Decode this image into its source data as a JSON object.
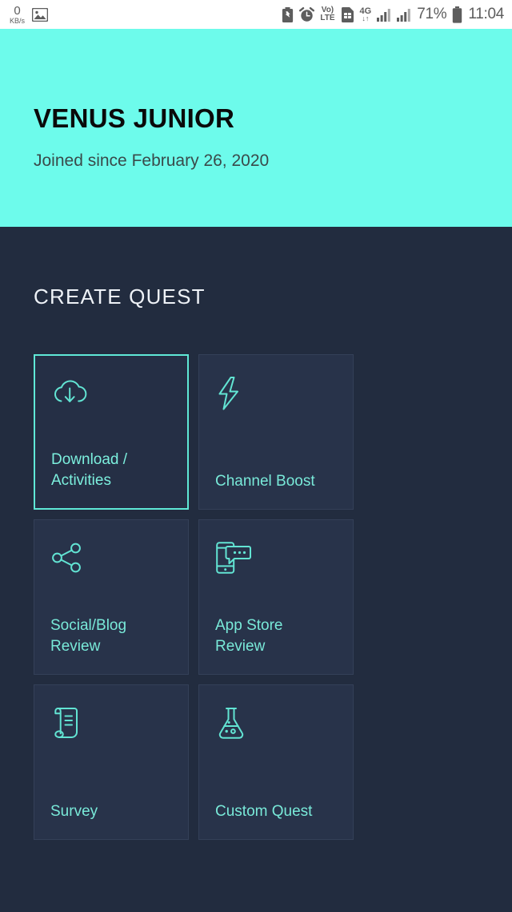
{
  "status_bar": {
    "network_speed_value": "0",
    "network_speed_unit": "KB/s",
    "photo_icon": "image-icon",
    "battery_saver_icon": "battery-saver-icon",
    "alarm_icon": "alarm-clock-icon",
    "volte_line1": "Vo)",
    "volte_line2": "LTE",
    "sim_icon": "sim-card-icon",
    "network_type": "4G",
    "data_arrows": "↓↑",
    "signal_icon_1": "signal-bars-icon",
    "signal_icon_2": "signal-bars-icon",
    "battery_percent": "71%",
    "battery_icon": "battery-icon",
    "time": "11:04"
  },
  "profile": {
    "name": "VENUS JUNIOR",
    "joined": "Joined since February 26, 2020",
    "background_color": "#6dfbeb"
  },
  "main": {
    "section_title": "CREATE QUEST",
    "accent_color": "#5fe8d6",
    "background_color": "#222c3f",
    "cards": [
      {
        "label": "Download / Activities",
        "icon": "cloud-download-icon",
        "selected": true
      },
      {
        "label": "Channel Boost",
        "icon": "lightning-bolt-icon",
        "selected": false
      },
      {
        "label": "Social/Blog Review",
        "icon": "share-nodes-icon",
        "selected": false
      },
      {
        "label": "App Store Review",
        "icon": "phone-chat-icon",
        "selected": false
      },
      {
        "label": "Survey",
        "icon": "scroll-document-icon",
        "selected": false
      },
      {
        "label": "Custom Quest",
        "icon": "flask-icon",
        "selected": false
      }
    ]
  }
}
